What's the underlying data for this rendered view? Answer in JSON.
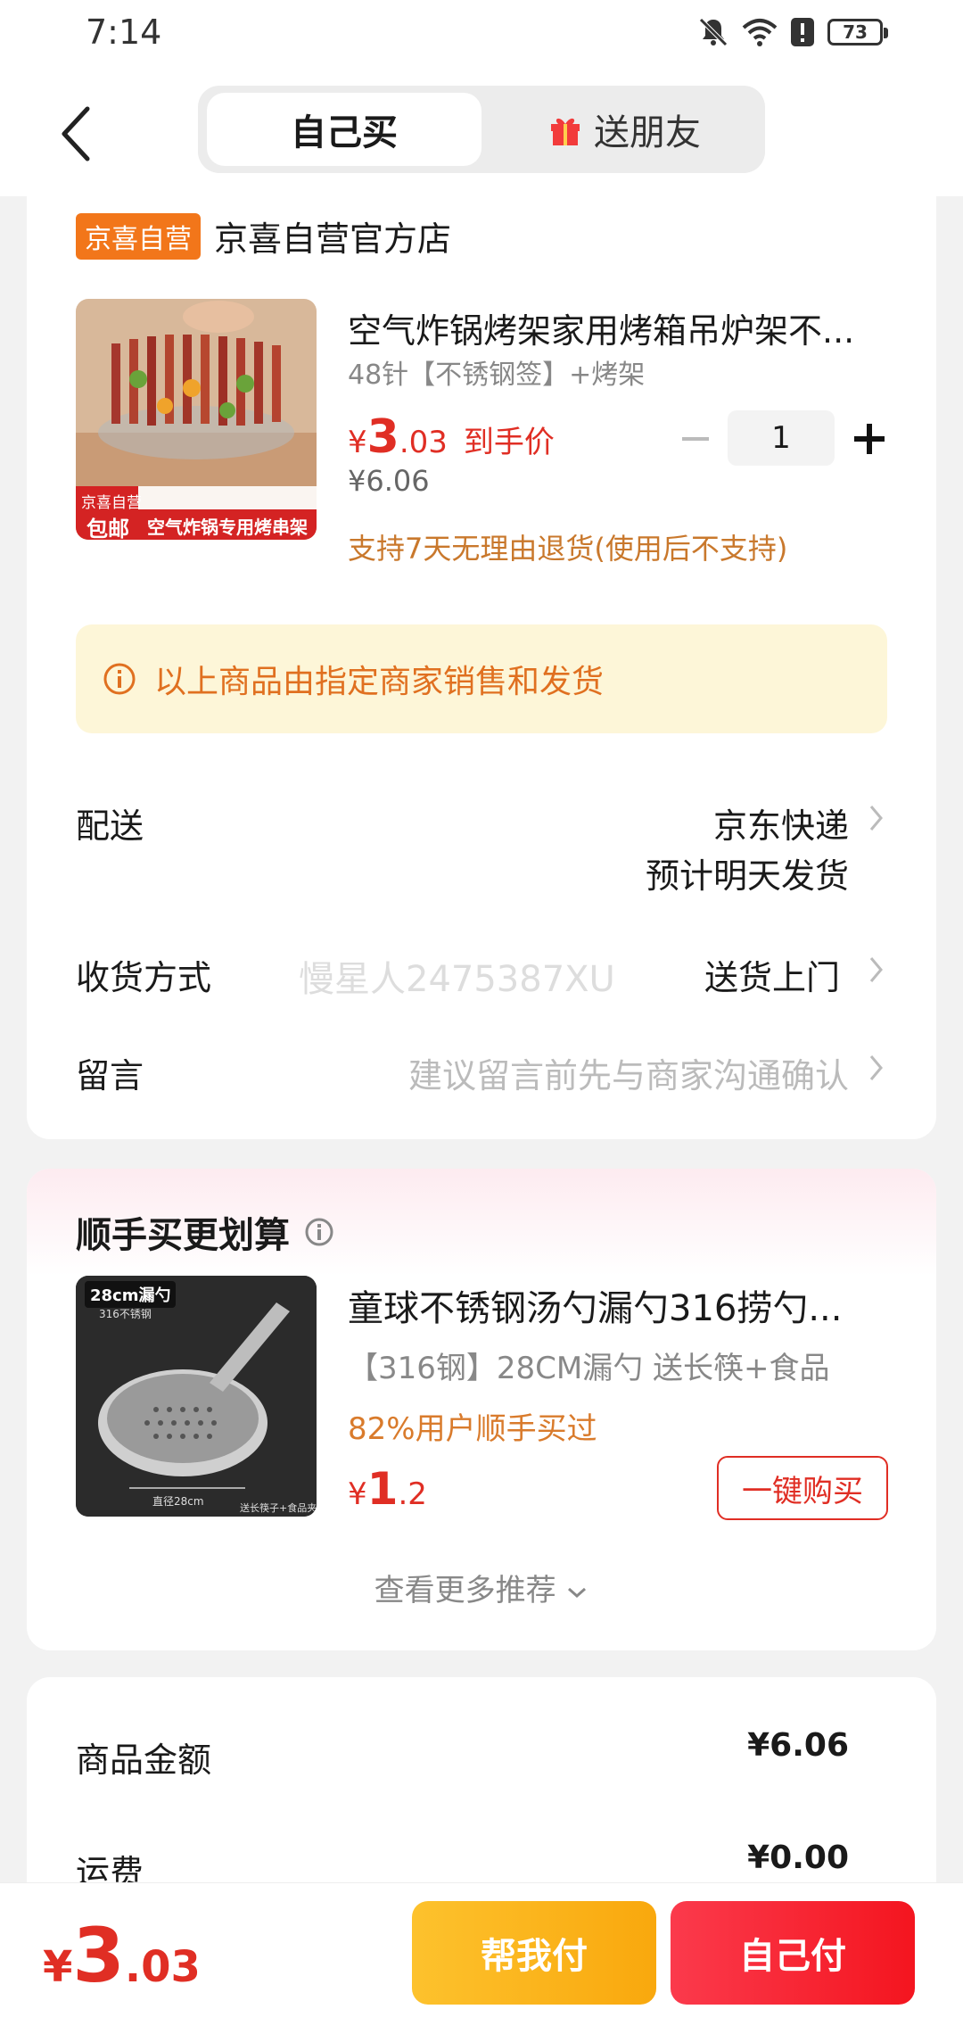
{
  "status_bar": {
    "time": "7:14",
    "battery": "73"
  },
  "header": {
    "tab_self": "自己买",
    "tab_friend": "送朋友"
  },
  "store": {
    "badge": "京喜自营",
    "name": "京喜自营官方店"
  },
  "product": {
    "title": "空气炸锅烤架家用烤箱吊炉架不...",
    "spec": "48针【不锈钢签】+烤架",
    "price_symbol": "¥",
    "price_int": "3",
    "price_dec": ".03",
    "price_label": "到手价",
    "original_price": "¥6.06",
    "quantity": "1",
    "return_policy": "支持7天无理由退货(使用后不支持)",
    "image_badge_top": "京喜自营",
    "image_badge_bottom": "包邮",
    "image_banner": "空气炸锅专用烤串架"
  },
  "notice": {
    "text": "以上商品由指定商家销售和发货"
  },
  "delivery": {
    "label": "配送",
    "carrier": "京东快递",
    "estimate": "预计明天发货"
  },
  "receive": {
    "label": "收货方式",
    "value": "送货上门",
    "watermark": "慢星人2475387XU"
  },
  "message": {
    "label": "留言",
    "placeholder": "建议留言前先与商家沟通确认"
  },
  "recommend": {
    "section_title": "顺手买更划算",
    "title": "童球不锈钢汤勺漏勺316捞勺...",
    "spec": "【316钢】28CM漏勺 送长筷+食品",
    "percent_text": "82%用户顺手买过",
    "price_symbol": "¥",
    "price_int": "1",
    "price_dec": ".2",
    "buy_label": "一键购买",
    "more_label": "查看更多推荐",
    "image_tag": "28cm漏勺",
    "image_sub": "316不锈钢",
    "image_caption": "直径28cm",
    "image_caption2": "送长筷子+食品夹"
  },
  "summary": {
    "goods_label": "商品金额",
    "goods_value": "¥6.06",
    "shipping_label": "运费",
    "shipping_value": "¥0.00"
  },
  "footer": {
    "total_symbol": "¥",
    "total_int": "3",
    "total_dec": ".03",
    "help_pay": "帮我付",
    "self_pay": "自己付"
  },
  "colors": {
    "accent_red": "#e02e24",
    "store_badge": "#f2761a",
    "notice_bg": "#fdf6d8",
    "help_btn": "#fdc22d",
    "self_btn": "#f4151f"
  }
}
